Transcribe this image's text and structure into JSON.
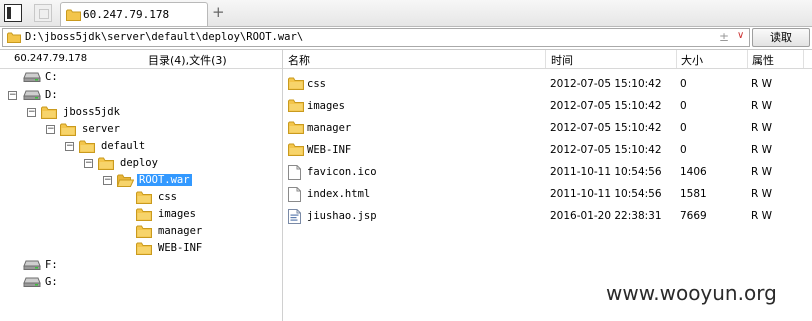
{
  "tab": {
    "title": "60.247.79.178",
    "add_label": "+"
  },
  "address": {
    "path": "D:\\jboss5jdk\\server\\default\\deploy\\ROOT.war\\",
    "sort_glyph": "±",
    "dropdown_glyph": "∨",
    "read_button": "读取"
  },
  "left": {
    "ip": "60.247.79.178",
    "count": "目录(4),文件(3)",
    "tree": [
      {
        "label": "C:",
        "icon": "drive-icon",
        "expander": ""
      },
      {
        "label": "D:",
        "icon": "drive-icon",
        "expander": "−"
      },
      {
        "label": "jboss5jdk",
        "icon": "folder-icon",
        "expander": "−"
      },
      {
        "label": "server",
        "icon": "folder-icon",
        "expander": "−"
      },
      {
        "label": "default",
        "icon": "folder-icon",
        "expander": "−"
      },
      {
        "label": "deploy",
        "icon": "folder-icon",
        "expander": "−"
      },
      {
        "label": "ROOT.war",
        "icon": "folder-open-icon",
        "expander": "−",
        "selected": true
      },
      {
        "label": "css",
        "icon": "folder-icon",
        "expander": ""
      },
      {
        "label": "images",
        "icon": "folder-icon",
        "expander": ""
      },
      {
        "label": "manager",
        "icon": "folder-icon",
        "expander": ""
      },
      {
        "label": "WEB-INF",
        "icon": "folder-icon",
        "expander": ""
      },
      {
        "label": "F:",
        "icon": "drive-icon",
        "expander": ""
      },
      {
        "label": "G:",
        "icon": "drive-icon",
        "expander": ""
      }
    ]
  },
  "list": {
    "columns": {
      "name": "名称",
      "time": "时间",
      "size": "大小",
      "attr": "属性"
    },
    "rows": [
      {
        "name": "css",
        "time": "2012-07-05 15:10:42",
        "size": "0",
        "attr": "R W",
        "icon": "folder-icon"
      },
      {
        "name": "images",
        "time": "2012-07-05 15:10:42",
        "size": "0",
        "attr": "R W",
        "icon": "folder-icon"
      },
      {
        "name": "manager",
        "time": "2012-07-05 15:10:42",
        "size": "0",
        "attr": "R W",
        "icon": "folder-icon"
      },
      {
        "name": "WEB-INF",
        "time": "2012-07-05 15:10:42",
        "size": "0",
        "attr": "R W",
        "icon": "folder-icon"
      },
      {
        "name": "favicon.ico",
        "time": "2011-10-11 10:54:56",
        "size": "1406",
        "attr": "R W",
        "icon": "file-icon"
      },
      {
        "name": "index.html",
        "time": "2011-10-11 10:54:56",
        "size": "1581",
        "attr": "R W",
        "icon": "file-icon"
      },
      {
        "name": "jiushao.jsp",
        "time": "2016-01-20 22:38:31",
        "size": "7669",
        "attr": "R W",
        "icon": "script-file-icon"
      }
    ]
  },
  "watermark": "www.wooyun.org",
  "colors": {
    "folder": "#f3c54b",
    "folder_edge": "#c99a1e",
    "selection": "#3399ff"
  }
}
